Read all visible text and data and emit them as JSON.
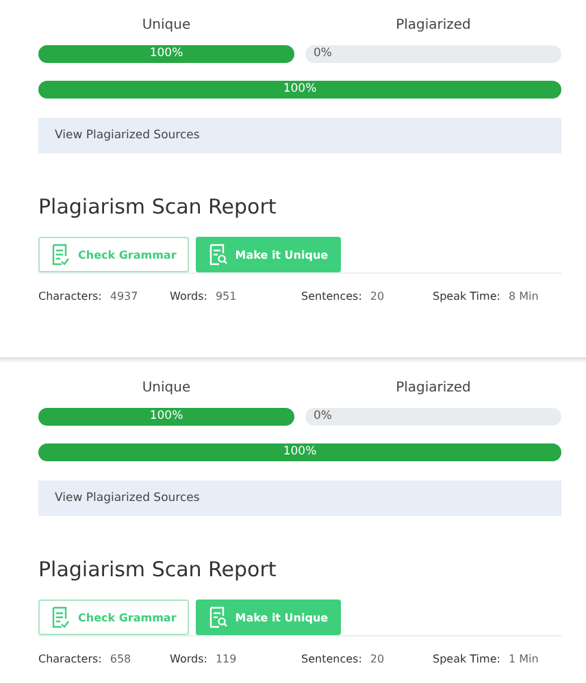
{
  "reports": [
    {
      "unique": {
        "label": "Unique",
        "level": 1,
        "reading": "100%"
      },
      "plagiarized": {
        "label": "Plagiarized",
        "level": 0,
        "reading": "0%"
      },
      "overall": {
        "level": 1,
        "reading": "100%"
      },
      "sources_link": "View Plagiarized Sources",
      "title": "Plagiarism Scan Report",
      "buttons": [
        {
          "label": "Check Grammar",
          "kind": "outline"
        },
        {
          "label": "Make it Unique",
          "kind": "solid"
        }
      ],
      "stats": [
        {
          "label": "Characters:",
          "value": "4937"
        },
        {
          "label": "Words:",
          "value": "951"
        },
        {
          "label": "Sentences:",
          "value": "20"
        },
        {
          "label": "Speak Time:",
          "value": "8 Min"
        }
      ]
    },
    {
      "unique": {
        "label": "Unique",
        "level": 1,
        "reading": "100%"
      },
      "plagiarized": {
        "label": "Plagiarized",
        "level": 0,
        "reading": "0%"
      },
      "overall": {
        "level": 1,
        "reading": "100%"
      },
      "sources_link": "View Plagiarized Sources",
      "title": "Plagiarism Scan Report",
      "buttons": [
        {
          "label": "Check Grammar",
          "kind": "outline"
        },
        {
          "label": "Make it Unique",
          "kind": "solid"
        }
      ],
      "stats": [
        {
          "label": "Characters:",
          "value": "658"
        },
        {
          "label": "Words:",
          "value": "119"
        },
        {
          "label": "Sentences:",
          "value": "20"
        },
        {
          "label": "Speak Time:",
          "value": "1 Min"
        }
      ]
    }
  ]
}
